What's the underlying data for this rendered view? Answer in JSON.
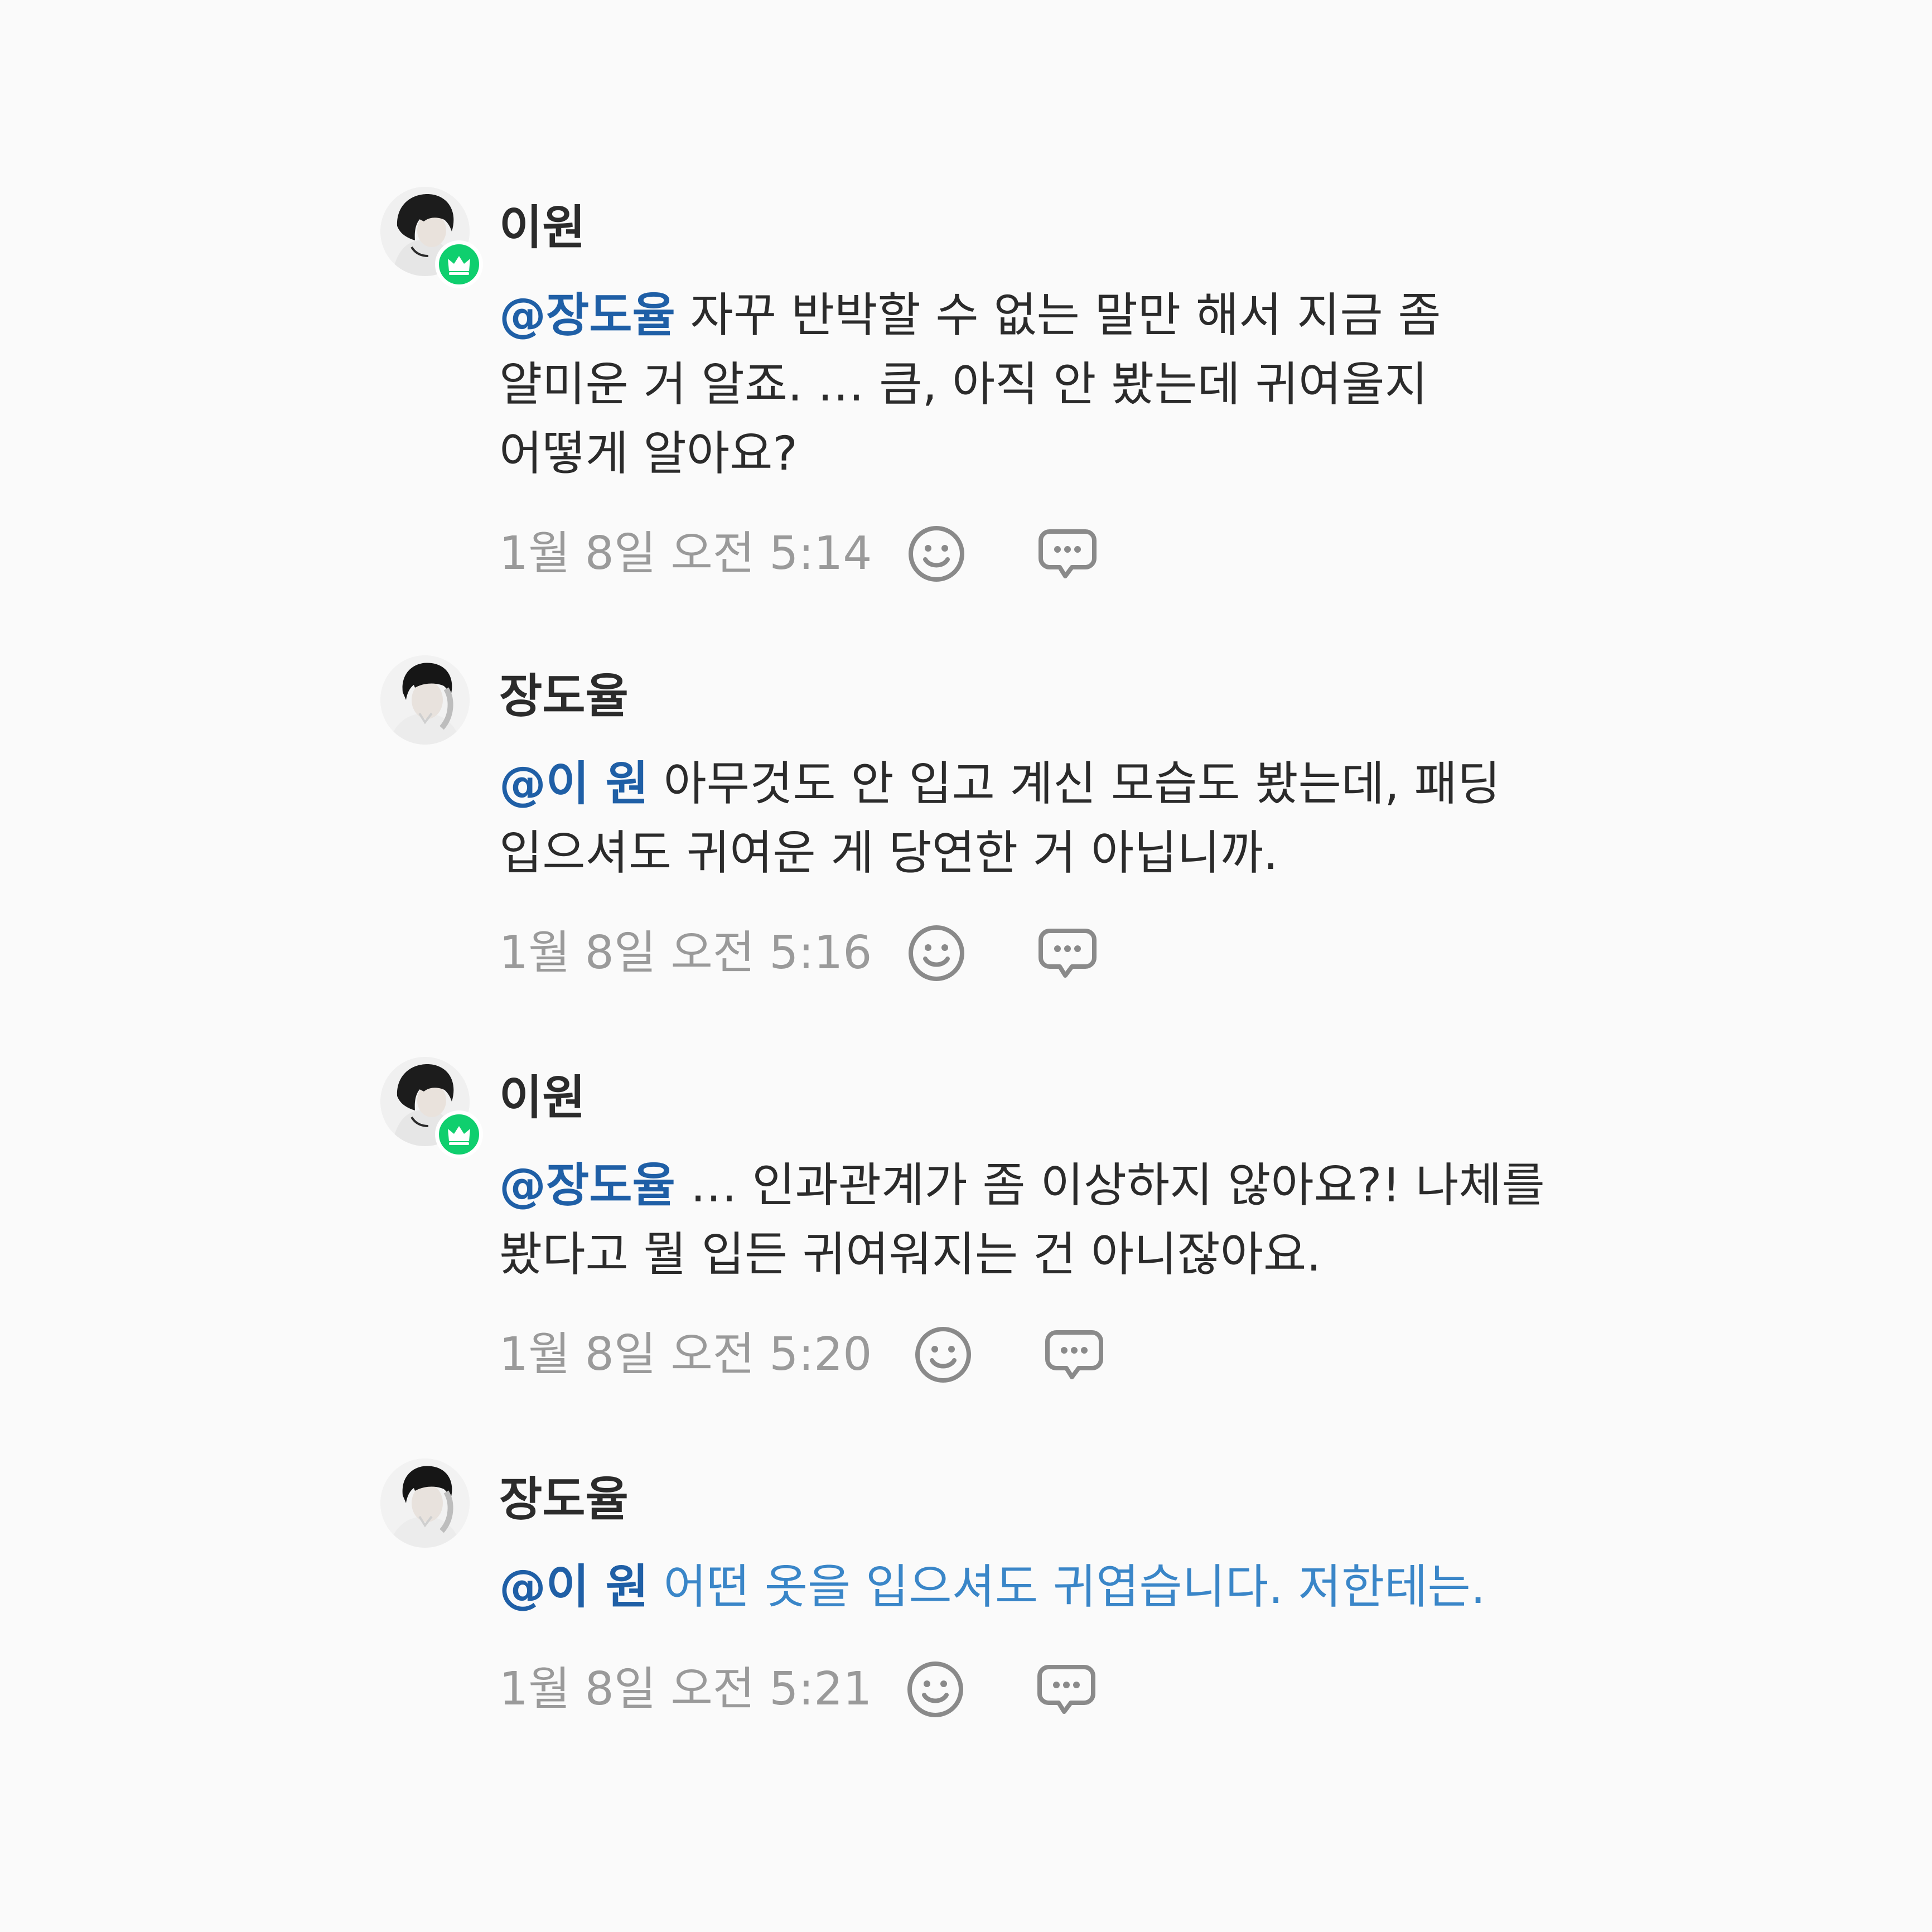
{
  "comments": [
    {
      "author": "이원",
      "mention": "@장도율",
      "text": " 자꾸 반박할 수 없는 말만 해서 지금 좀 얄미운 거 알죠. … 큼, 아직 안 봤는데 귀여울지 어떻게 알아요?",
      "time": "1월 8일 오전 5:14",
      "badge_icon": "crown-icon",
      "avatar": "female-portrait"
    },
    {
      "author": "장도율",
      "mention": "@이 원",
      "text": " 아무것도 안 입고 계신 모습도 봤는데, 패딩 입으셔도 귀여운 게 당연한 거 아닙니까.",
      "time": "1월 8일 오전 5:16",
      "avatar": "male-portrait"
    },
    {
      "author": "이원",
      "mention": "@장도율",
      "text": " … 인과관계가 좀 이상하지 않아요?! 나체를 봤다고 뭘 입든 귀여워지는 건 아니잖아요.",
      "time": "1월 8일 오전 5:20",
      "badge_icon": "crown-icon",
      "avatar": "female-portrait"
    },
    {
      "author": "장도율",
      "mention": "@이 원",
      "text": " 어떤 옷을 입으셔도 귀엽습니다. 저한테는.",
      "time": "1월 8일 오전 5:21",
      "avatar": "male-portrait",
      "text_color": "#3a86c8"
    }
  ],
  "actions": {
    "react_icon": "smiley-icon",
    "reply_icon": "speech-bubble-icon"
  },
  "colors": {
    "background": "#fafafa",
    "mention": "#1f5fa6",
    "highlight_text": "#3a86c8",
    "badge": "#0fcf6e",
    "muted": "#9a9a9a",
    "icon": "#8a8a8a"
  }
}
